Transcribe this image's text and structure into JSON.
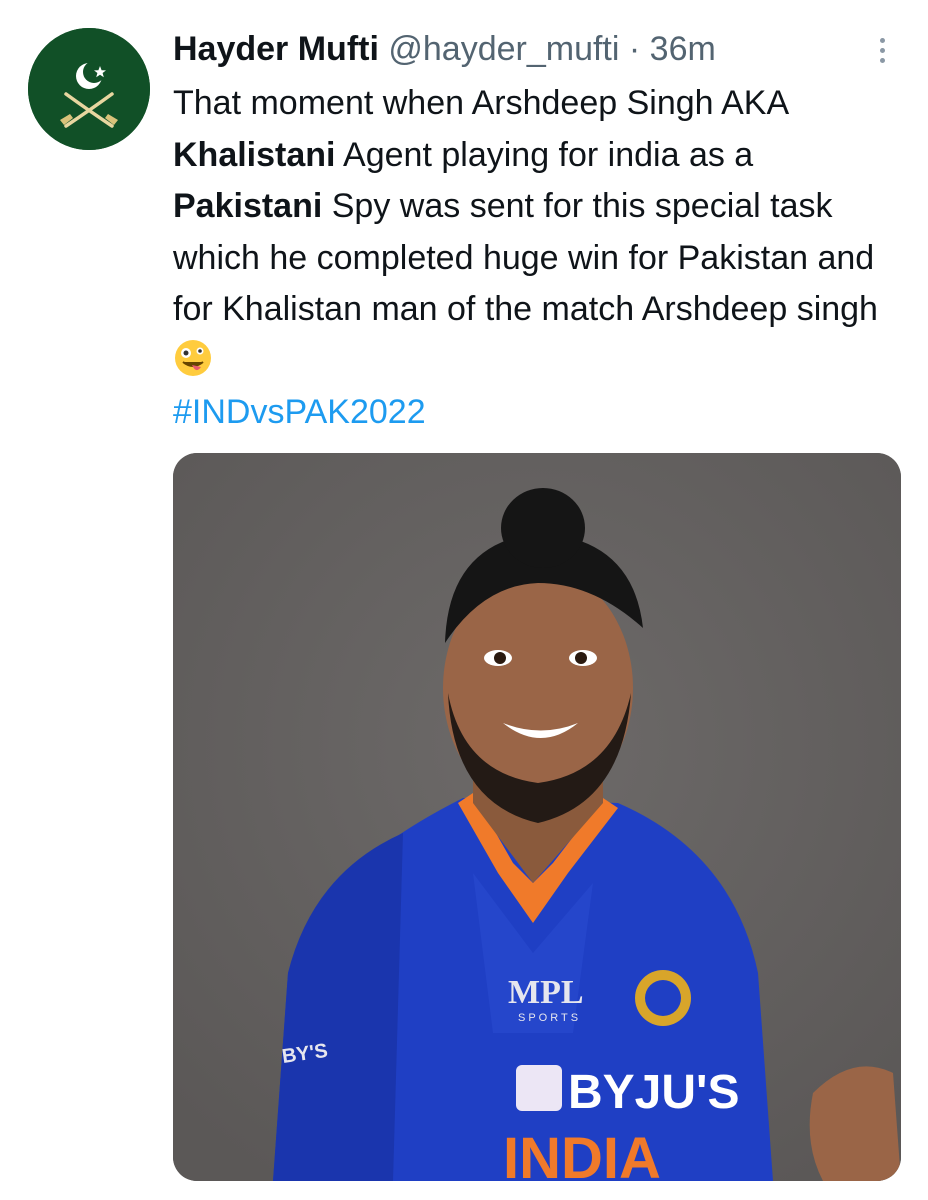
{
  "tweet": {
    "author_name": "Hayder Mufti",
    "author_handle": "@hayder_mufti",
    "separator": "·",
    "time": "36m",
    "text_parts": {
      "p1": "That moment when Arshdeep Singh AKA ",
      "b1": "Khalistani",
      "p2": " Agent playing for india as a ",
      "b2": "Pakistani",
      "p3": " Spy was sent for this special task which he completed huge win for Pakistan and for Khalistan man of the match Arshdeep singh "
    },
    "hashtag": "#INDvsPAK2022",
    "emoji": "zany-face-emoji"
  },
  "media": {
    "jersey_sponsor": "MPL",
    "jersey_sponsor_sub": "SPORTS",
    "jersey_front": "BYJU'S",
    "sleeve_text": "BY'S",
    "bottom_text": "INDIA"
  },
  "colors": {
    "link": "#1d9bf0",
    "secondary": "#536471",
    "avatar_bg": "#115027",
    "photo_bg": "#656261",
    "jersey_blue": "#1f3fc4"
  }
}
